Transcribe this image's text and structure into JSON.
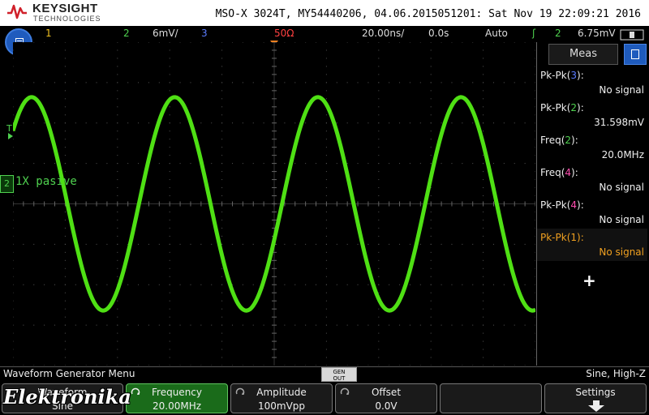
{
  "header": {
    "brand_name": "KEYSIGHT",
    "brand_sub": "TECHNOLOGIES",
    "device_info": "MSO-X 3024T, MY54440206, 04.06.2015051201: Sat Nov 19 22:09:21 2016"
  },
  "channel_bar": {
    "ch1": "1",
    "ch2": "2",
    "ch2_scale": "6mV/",
    "ch3": "3",
    "impedance": "50Ω",
    "timebase": "20.00ns/",
    "delay": "0.0s",
    "trigger_mode": "Auto",
    "trigger_source": "2",
    "trigger_level": "6.75mV"
  },
  "waveform": {
    "channel_label": "2",
    "label_text": "1X pasive",
    "trigger_marker": "T",
    "cycles_visible": 3.65,
    "amplitude_fraction": 0.33
  },
  "meas_panel": {
    "title": "Meas",
    "add_symbol": "+",
    "items": [
      {
        "label_prefix": "Pk-Pk(",
        "channel": "3",
        "label_suffix": "):",
        "value": "No signal",
        "channel_color": "#5b7cff"
      },
      {
        "label_prefix": "Pk-Pk(",
        "channel": "2",
        "label_suffix": "):",
        "value": "31.598mV",
        "channel_color": "#4fd14f"
      },
      {
        "label_prefix": "Freq(",
        "channel": "2",
        "label_suffix": "):",
        "value": "20.0MHz",
        "channel_color": "#4fd14f"
      },
      {
        "label_prefix": "Freq(",
        "channel": "4",
        "label_suffix": "):",
        "value": "No signal",
        "channel_color": "#ff4fb0"
      },
      {
        "label_prefix": "Pk-Pk(",
        "channel": "4",
        "label_suffix": "):",
        "value": "No signal",
        "channel_color": "#ff4fb0"
      },
      {
        "label_prefix": "Pk-Pk(",
        "channel": "1",
        "label_suffix": "):",
        "value": "No signal",
        "channel_color": "#f0a020"
      }
    ]
  },
  "menu": {
    "title": "Waveform Generator Menu",
    "gen_badge_top": "GEN",
    "gen_badge_bottom": "OUT",
    "status": "Sine, High-Z"
  },
  "softkeys": [
    {
      "title": "Waveform",
      "value": "Sine"
    },
    {
      "title": "Frequency",
      "value": "20.00MHz"
    },
    {
      "title": "Amplitude",
      "value": "100mVpp"
    },
    {
      "title": "Offset",
      "value": "0.0V"
    },
    {
      "title": "Settings",
      "value": ""
    }
  ],
  "watermark": "Elektronika",
  "colors": {
    "ch1": "#f0c020",
    "ch2": "#4fd14f",
    "ch3": "#5b7cff",
    "impedance": "#ff4040",
    "trace": "#4fe014",
    "accent_blue": "#1f5bbd"
  }
}
